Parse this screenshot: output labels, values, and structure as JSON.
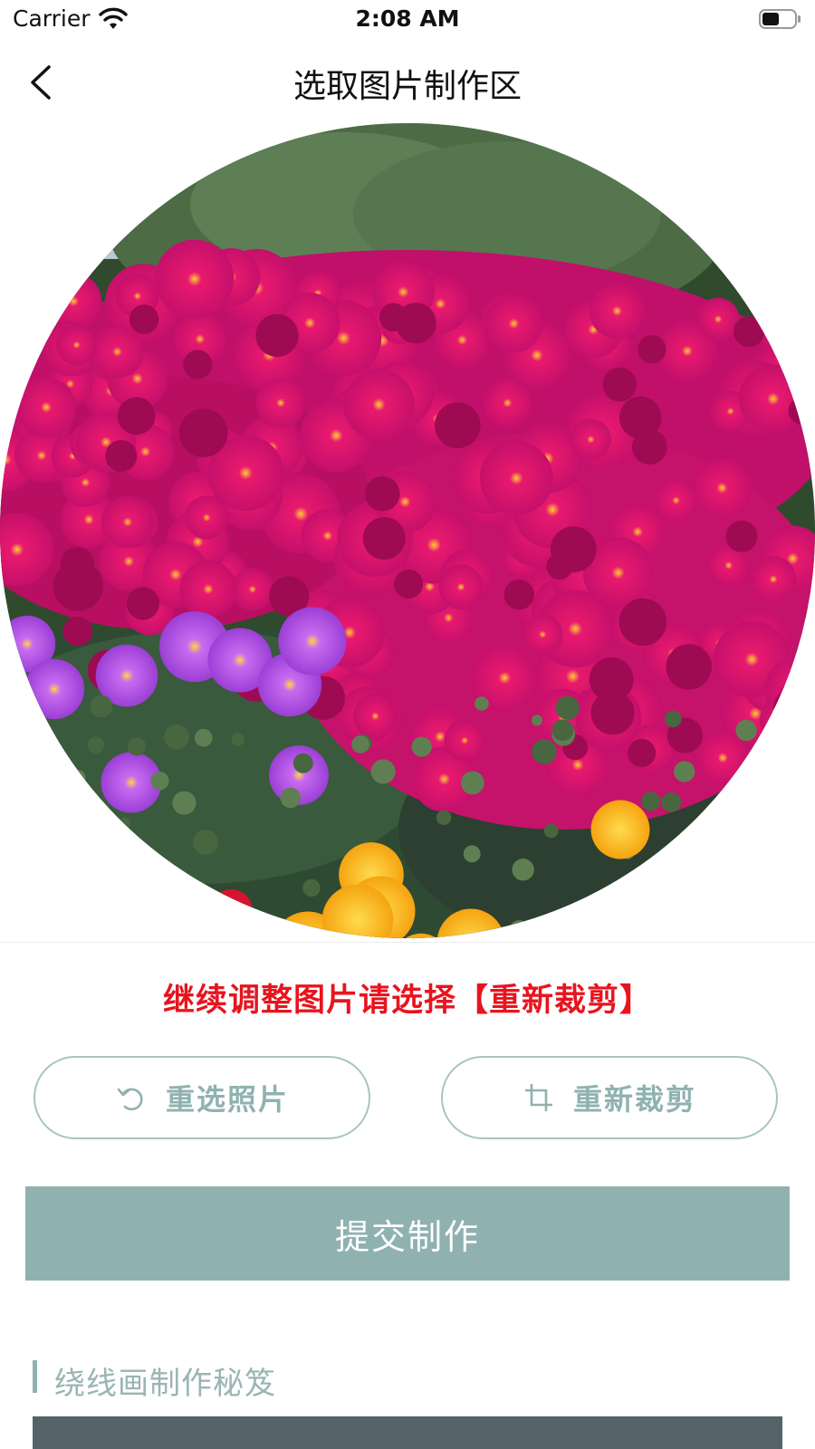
{
  "status_bar": {
    "carrier": "Carrier",
    "time": "2:08 AM",
    "battery_icon": "battery-icon",
    "wifi_icon": "wifi-icon"
  },
  "nav": {
    "back_icon": "chevron-left-icon",
    "title": "选取图片制作区"
  },
  "photo": {
    "shape": "circle",
    "subject": "flowers"
  },
  "hint_text": "继续调整图片请选择【重新裁剪】",
  "actions": {
    "reselect_label": "重选照片",
    "reselect_icon": "rotate-icon",
    "recrop_label": "重新裁剪",
    "recrop_icon": "crop-icon",
    "submit_label": "提交制作"
  },
  "section": {
    "title": "绕线画制作秘笈"
  },
  "colors": {
    "accent": "#8fb2b0",
    "hint": "#e8141e",
    "panel": "#566269"
  }
}
